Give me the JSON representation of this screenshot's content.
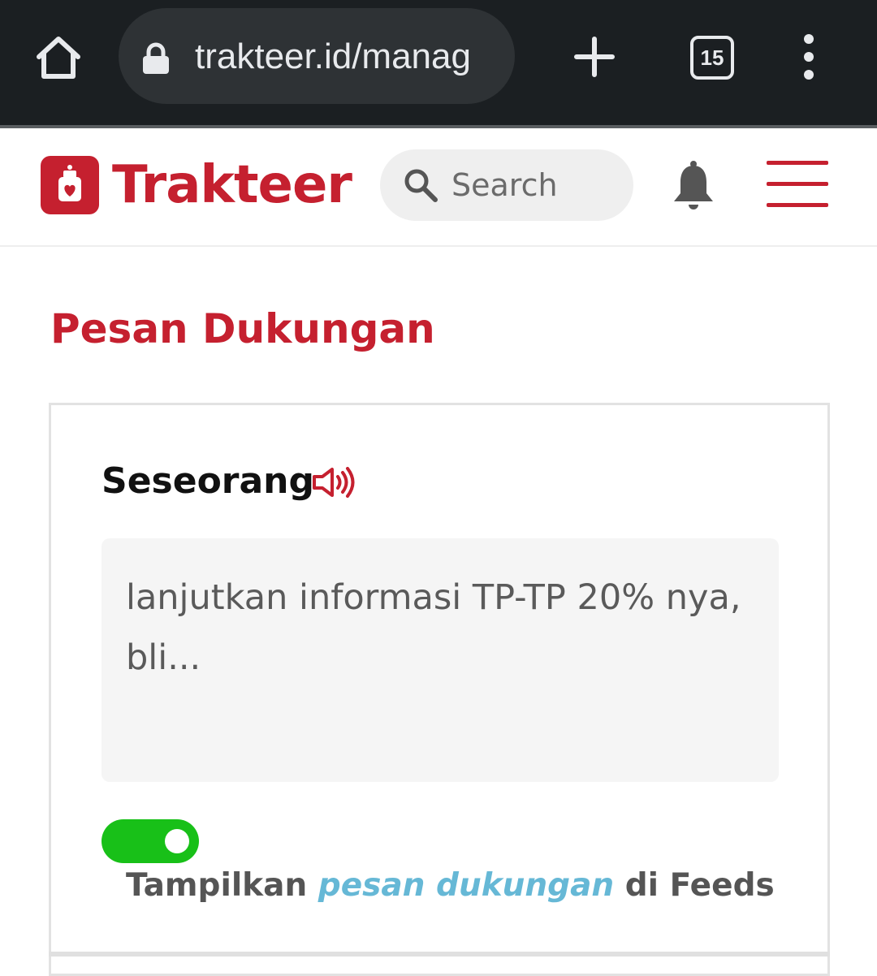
{
  "browser": {
    "url": "trakteer.id/manag",
    "tab_count": "15"
  },
  "header": {
    "logo_text": "Trakteer",
    "search_placeholder": "Search",
    "brand_color": "#c5202f"
  },
  "page": {
    "title": "Pesan Dukungan"
  },
  "card": {
    "supporter_name": "Seseorang",
    "message": "lanjutkan informasi TP-TP 20% nya, bli...",
    "toggle_on": true,
    "feeds_label_prefix": "Tampilkan",
    "feeds_label_link": "pesan dukungan",
    "feeds_label_suffix": "di Feeds"
  },
  "icons": [
    "home-icon",
    "lock-icon",
    "plus-icon",
    "tabs-icon",
    "more-vert-icon",
    "trakteer-logo-icon",
    "search-icon",
    "bell-icon",
    "hamburger-icon",
    "speaker-icon"
  ]
}
